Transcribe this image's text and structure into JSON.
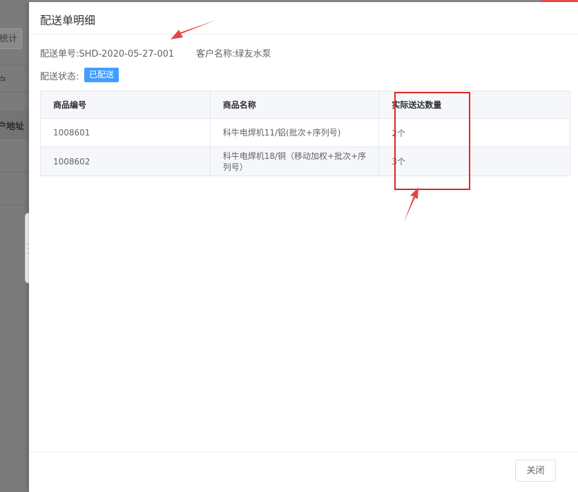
{
  "background": {
    "button_label": "统计",
    "cell_1": "户",
    "cell_2": "户地址"
  },
  "drawer": {
    "title": "配送单明细",
    "order_no": "配送单号:SHD-2020-05-27-001",
    "customer": "客户名称:绿友水泵",
    "status_label": "配送状态:",
    "status_tag": "已配送",
    "table": {
      "headers": [
        "商品编号",
        "商品名称",
        "实际送达数量"
      ],
      "rows": [
        [
          "1008601",
          "科牛电焊机11/铝(批次+序列号)",
          "2个"
        ],
        [
          "1008602",
          "科牛电焊机18/铜（移动加权+批次+序列号）",
          "3个"
        ]
      ]
    },
    "close_label": "关闭"
  },
  "colors": {
    "primary": "#409eff",
    "annotation_red": "#e02424"
  }
}
